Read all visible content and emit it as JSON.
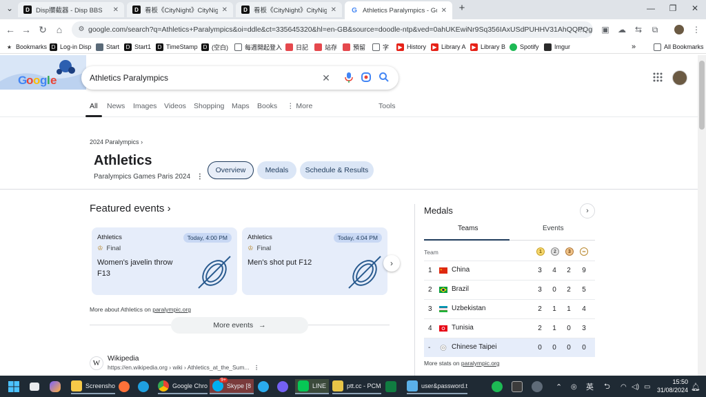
{
  "browser": {
    "tabs": [
      {
        "title": "Disp攔截器 - Disp BBS",
        "active": false
      },
      {
        "title": "看板《CityNight》CityNight - Disp",
        "active": false
      },
      {
        "title": "看板《CityNight》CityNight - Disp",
        "active": false
      },
      {
        "title": "Athletics Paralympics - Google S",
        "active": true
      }
    ],
    "url": "google.com/search?q=Athletics+Paralympics&oi=ddle&ct=335645320&hl=en-GB&source=doodle-ntp&ved=0ahUKEwiNr9Sq356IAxUSdPUHHV31AhQQPQgB",
    "bookmarks": [
      "Bookmarks",
      "Log-in Disp",
      "Start",
      "Start1",
      "TimeStamp",
      "(空白)",
      "每週開起登入",
      "日記",
      "站存",
      "預留",
      "字",
      "History",
      "Library A",
      "Library B",
      "Spotify",
      "Imgur"
    ],
    "all_bookmarks": "All Bookmarks"
  },
  "search": {
    "query": "Athletics Paralympics",
    "tabs": [
      "All",
      "News",
      "Images",
      "Videos",
      "Shopping",
      "Maps",
      "Books",
      "More"
    ],
    "active_tab": "All",
    "tools": "Tools"
  },
  "header": {
    "breadcrumb": "2024 Paralympics",
    "title": "Athletics",
    "subtitle": "Paralympics Games Paris 2024",
    "chips": [
      "Overview",
      "Medals",
      "Schedule & Results"
    ]
  },
  "featured": {
    "title": "Featured events",
    "events": [
      {
        "sport": "Athletics",
        "time": "Today, 4:00 PM",
        "stage": "Final",
        "name": "Women's javelin throw F13"
      },
      {
        "sport": "Athletics",
        "time": "Today, 4:04 PM",
        "stage": "Final",
        "name": "Men's shot put F12"
      }
    ],
    "more_about_prefix": "More about Athletics on",
    "more_about_link": "paralympic.org",
    "more_events": "More events"
  },
  "wiki": {
    "name": "Wikipedia",
    "url": "https://en.wikipedia.org › wiki › Athletics_at_the_Sum..."
  },
  "medals": {
    "title": "Medals",
    "tabs": [
      "Teams",
      "Events"
    ],
    "team_header": "Team",
    "rows": [
      {
        "rank": "1",
        "country": "China",
        "gold": "3",
        "silver": "4",
        "bronze": "2",
        "total": "9",
        "highlight": false
      },
      {
        "rank": "2",
        "country": "Brazil",
        "gold": "3",
        "silver": "0",
        "bronze": "2",
        "total": "5",
        "highlight": false
      },
      {
        "rank": "3",
        "country": "Uzbekistan",
        "gold": "2",
        "silver": "1",
        "bronze": "1",
        "total": "4",
        "highlight": false
      },
      {
        "rank": "4",
        "country": "Tunisia",
        "gold": "2",
        "silver": "1",
        "bronze": "0",
        "total": "3",
        "highlight": false
      },
      {
        "rank": "-",
        "country": "Chinese Taipei",
        "gold": "0",
        "silver": "0",
        "bronze": "0",
        "total": "0",
        "highlight": true
      }
    ],
    "more_stats_prefix": "More stats on",
    "more_stats_link": "paralympic.org"
  },
  "taskbar": {
    "items": [
      "Screensho",
      "Google Chro",
      "Skype [8",
      "LINE",
      "ptt.cc - PCM",
      "user&password.t"
    ],
    "skype_badge": "9+",
    "ime": "英",
    "time": "15:50",
    "date": "31/08/2024"
  },
  "colors": {
    "accent": "#1f3b5c",
    "card_bg": "#e6edfa",
    "chip_bg": "#dbe6f6"
  }
}
